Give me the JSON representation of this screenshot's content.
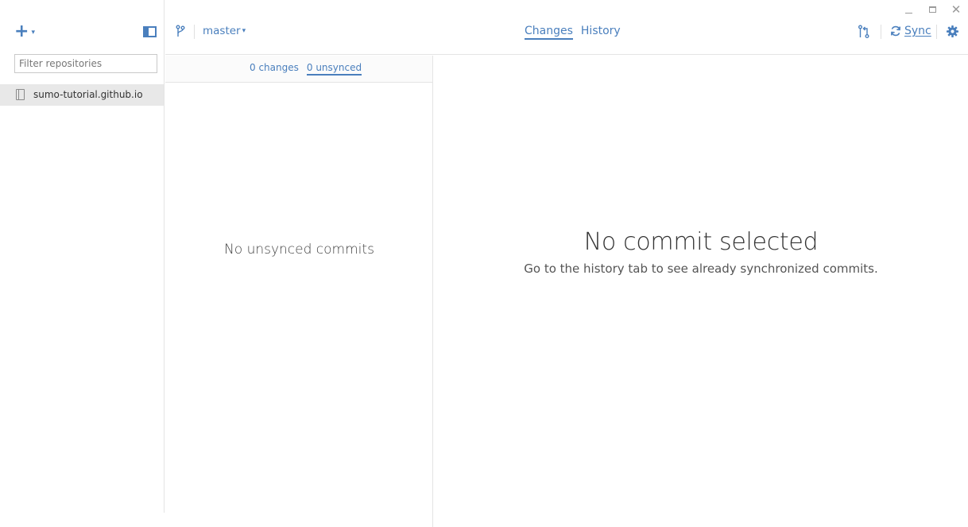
{
  "window": {
    "minimize_icon": "minimize-icon",
    "maximize_icon": "maximize-icon",
    "close_label": "✕"
  },
  "sidebar": {
    "add_icon": "plus-icon",
    "add_label": "+",
    "add_caret": "▾",
    "toggle_icon": "sidebar-toggle-icon",
    "filter": {
      "placeholder": "Filter repositories",
      "value": ""
    },
    "repositories": [
      {
        "name": "sumo-tutorial.github.io",
        "icon": "repo-icon",
        "selected": true
      }
    ]
  },
  "toolbar": {
    "branch_icon": "branch-icon",
    "branch": "master",
    "branch_caret": "▾",
    "tabs": [
      {
        "label": "Changes",
        "active": true
      },
      {
        "label": "History",
        "active": false
      }
    ],
    "pull_request_icon": "pull-request-icon",
    "sync_icon": "sync-icon",
    "sync_label": "Sync",
    "settings_icon": "gear-icon"
  },
  "middle": {
    "subtabs": [
      {
        "label": "0 changes",
        "active": false
      },
      {
        "label": "0 unsynced",
        "active": true
      }
    ],
    "empty_message": "No unsynced commits"
  },
  "detail": {
    "title": "No commit selected",
    "subtitle": "Go to the history tab to see already synchronized commits."
  },
  "colors": {
    "accent": "#4a7fbd",
    "selected_row": "#e8e8e8",
    "divider": "#e4e4e4"
  }
}
